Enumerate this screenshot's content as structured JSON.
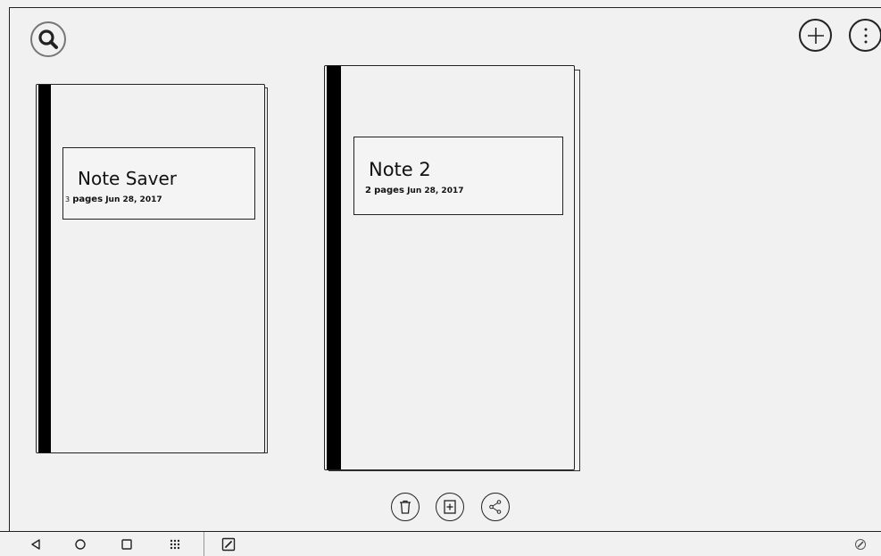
{
  "toolbar": {
    "search_icon": "search-icon",
    "add_icon": "plus-icon",
    "more_icon": "more-vertical-icon"
  },
  "notebooks": [
    {
      "title": "Note Saver",
      "page_count": "3",
      "pages_label": "pages",
      "date": "Jun 28, 2017"
    },
    {
      "title": "Note 2",
      "page_count": "2",
      "pages_label": "pages",
      "date": "Jun 28, 2017"
    }
  ],
  "actions": {
    "delete_icon": "trash-icon",
    "add_page_icon": "add-page-icon",
    "share_icon": "share-icon"
  },
  "navbar": {
    "back_icon": "back-triangle-icon",
    "home_icon": "home-circle-icon",
    "recents_icon": "recents-square-icon",
    "apps_icon": "apps-grid-icon",
    "note_icon": "pen-note-icon",
    "stylus_icon": "stylus-icon"
  },
  "colors": {
    "background": "#f1f1f1",
    "ink": "#111111",
    "spine": "#000000"
  }
}
